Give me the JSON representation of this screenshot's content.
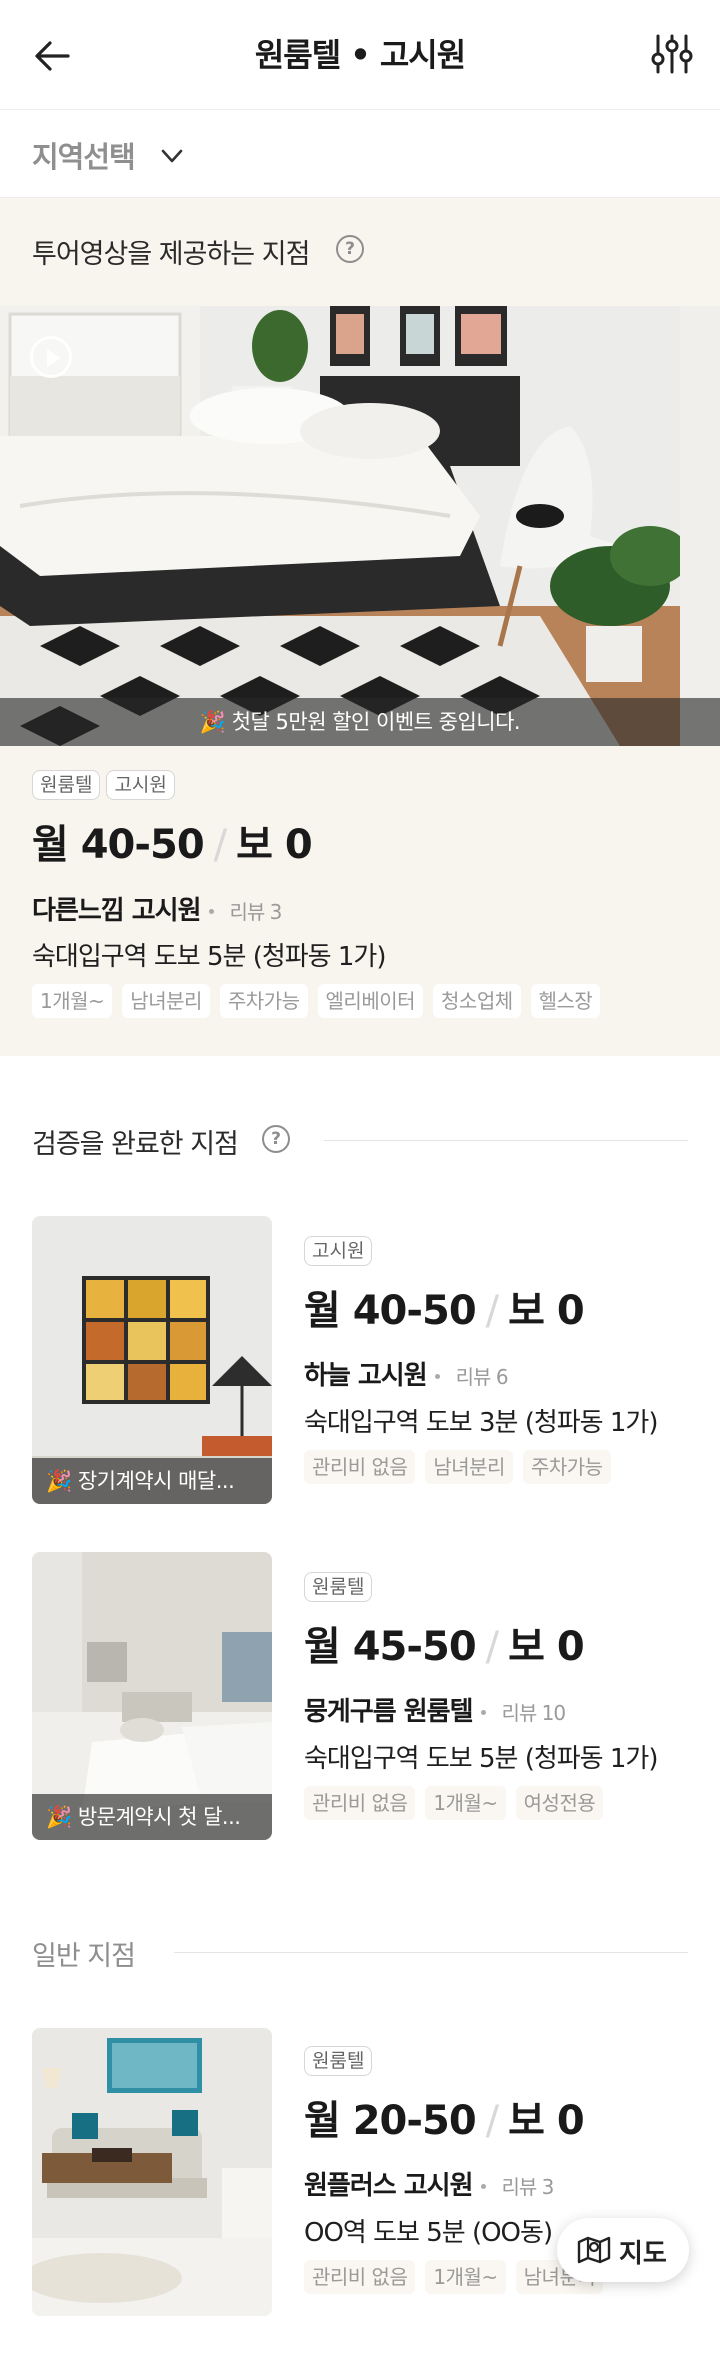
{
  "header": {
    "title": "원룸텔 • 고시원"
  },
  "region": {
    "label": "지역선택"
  },
  "tour_section": {
    "title": "투어영상을 제공하는 지점",
    "help": "?",
    "banner": "🎉 첫달 5만원 할인 이벤트 중입니다.",
    "tags": [
      "원룸텔",
      "고시원"
    ],
    "price_month": "월 40-50",
    "price_sep": "/",
    "price_deposit": "보 0",
    "name": "다른느낌 고시원",
    "review": "리뷰 3",
    "address": "숙대입구역 도보 5분 (청파동 1가)",
    "features": [
      "1개월~",
      "남녀분리",
      "주차가능",
      "엘리베이터",
      "청소업체",
      "헬스장"
    ]
  },
  "verified_section": {
    "title": "검증을 완료한 지점",
    "help": "?",
    "items": [
      {
        "banner": "🎉 장기계약시 매달...",
        "tag": "고시원",
        "price_month": "월 40-50",
        "price_sep": "/",
        "price_deposit": "보 0",
        "name": "하늘 고시원",
        "review": "리뷰 6",
        "address": "숙대입구역 도보 3분 (청파동 1가)",
        "features": [
          "관리비 없음",
          "남녀분리",
          "주차가능"
        ]
      },
      {
        "banner": "🎉 방문계약시 첫 달...",
        "tag": "원룸텔",
        "price_month": "월 45-50",
        "price_sep": "/",
        "price_deposit": "보 0",
        "name": "뭉게구름 원룸텔",
        "review": "리뷰 10",
        "address": "숙대입구역 도보 5분 (청파동 1가)",
        "features": [
          "관리비 없음",
          "1개월~",
          "여성전용"
        ]
      }
    ]
  },
  "general_section": {
    "title": "일반 지점",
    "items": [
      {
        "tag": "원룸텔",
        "price_month": "월 20-50",
        "price_sep": "/",
        "price_deposit": "보 0",
        "name": "원플러스 고시원",
        "review": "리뷰 3",
        "address": "OO역 도보 5분 (OO동)",
        "features": [
          "관리비 없음",
          "1개월~",
          "남녀분리"
        ]
      }
    ]
  },
  "map_button": {
    "label": "지도"
  }
}
